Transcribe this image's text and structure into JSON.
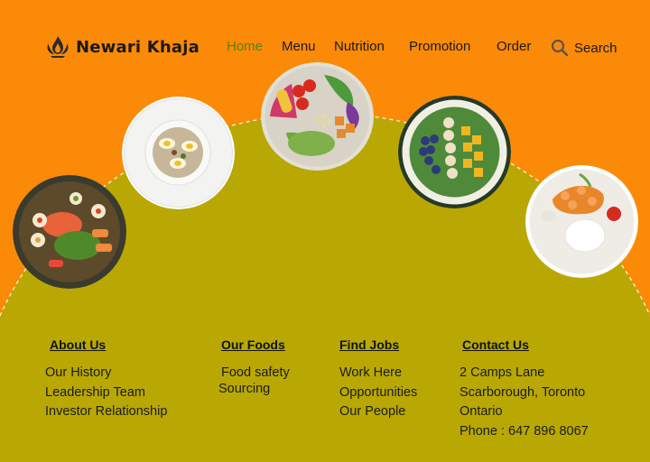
{
  "brand": {
    "name": "Newari Khaja",
    "logo_icon": "flame-icon"
  },
  "nav": {
    "items": [
      {
        "label": "Home",
        "active": true
      },
      {
        "label": "Menu",
        "active": false
      },
      {
        "label": "Nutrition",
        "active": false
      },
      {
        "label": "Promotion",
        "active": false
      },
      {
        "label": "Order",
        "active": false
      }
    ],
    "search_label": "Search",
    "search_icon": "search-icon",
    "active_color": "#5f7d15"
  },
  "theme": {
    "background": "#fb8a08",
    "hill": "#b9a803",
    "plate": "#ffffff"
  },
  "plates": [
    {
      "name": "sushi-platter",
      "icon": "food-plate-image"
    },
    {
      "name": "egg-rice-bowl",
      "icon": "food-plate-image"
    },
    {
      "name": "vegetable-salad-bowl",
      "icon": "food-plate-image"
    },
    {
      "name": "fruit-spinach-plate",
      "icon": "food-plate-image"
    },
    {
      "name": "curry-rice-plate",
      "icon": "food-plate-image"
    }
  ],
  "footer": {
    "about": {
      "heading": "About Us",
      "links": [
        "Our History",
        "Leadership Team",
        "Investor Relationship"
      ]
    },
    "foods": {
      "heading": "Our Foods",
      "links": [
        "Food safety",
        "Sourcing"
      ]
    },
    "jobs": {
      "heading": "Find Jobs",
      "links": [
        "Work Here",
        "Opportunities",
        "Our People"
      ]
    },
    "contact": {
      "heading": "Contact Us",
      "lines": [
        "2 Camps Lane",
        "Scarborough, Toronto",
        "Ontario",
        "Phone : 647 896 8067"
      ]
    }
  }
}
